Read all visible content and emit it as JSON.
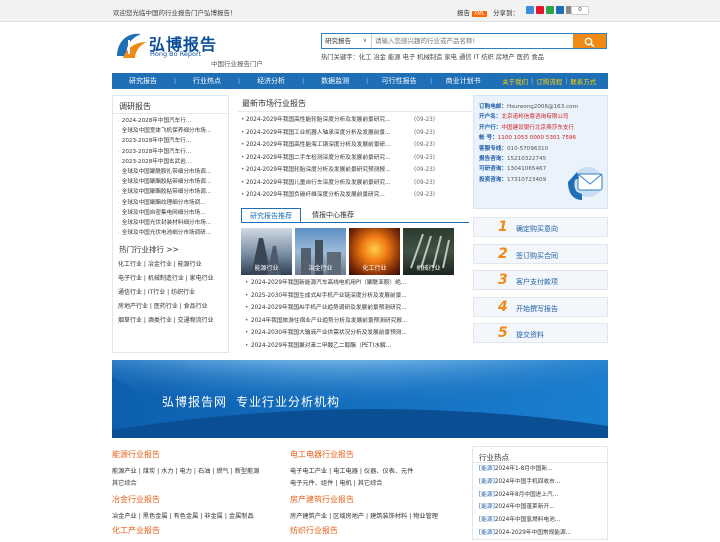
{
  "topbar": {
    "welcome": "欢迎您光临中国的行业报告门户弘博报告！",
    "rss": "报告",
    "xml": "XML",
    "share": "分享到：",
    "count": "0"
  },
  "logo": {
    "cn": "弘博报告",
    "en": "Hong Bo Report",
    "portal": "中国行业报告门户"
  },
  "search": {
    "select": "研究报告",
    "placeholder": "请输入您感兴趣的行业或产品名称!",
    "hot": "热门关键字：化工 冶金 能源 电子 机械制造 家电 通信 IT 纺织 房地产 医药 食品"
  },
  "nav": {
    "items": [
      "研究报告",
      "行业热点",
      "经济分析",
      "数据监测",
      "可行性报告",
      "商业计划书"
    ],
    "ext": [
      "关于我们",
      "订购流程",
      "联系方式"
    ]
  },
  "left": {
    "title": "调研报告",
    "items": [
      "2024-2028年中国汽车行...",
      "全球及中国宽体飞机保养细分市场...",
      "2023-2028年中国汽车行...",
      "2023-2028年中国汽车行...",
      "2023-2028年中国玄武岩...",
      "全球及中国聚酰胺扎带细分市场调...",
      "全球及中国聚酯胶粘带细分市场调...",
      "全球及中国聚酯胶粘带细分市场调...",
      "全球及中国聚酯纹理细分市场调...",
      "全球及中国自密集电网细分市场...",
      "全球及中国光伏封装材料细分市场...",
      "全球及中国光伏电池细分市场调研..."
    ],
    "hot_title": "热门行业排行  >>",
    "hot": [
      "化工行业 | 冶金行业 | 能源行业",
      "电子行业 | 机械制造行业 | 家电行业",
      "通信行业 | IT行业 | 纺织行业",
      "房地产行业 | 医药行业 | 食品行业",
      "烟草行业 | 酒类行业 | 交通物流行业"
    ]
  },
  "mid": {
    "title": "最新市场行业报告",
    "news": [
      {
        "t": "2024-2029年我国高性能轮胎深度分析及发展前景研究...",
        "d": "(09-23)"
      },
      {
        "t": "2024-2029年我国工业机器人轴承深度分析及发展前景...",
        "d": "(09-23)"
      },
      {
        "t": "2024-2029年我国高性能海工钢深度分析及发展前景研...",
        "d": "(09-23)"
      },
      {
        "t": "2024-2029年我国二手车检测深度分析及发展前景研究...",
        "d": "(09-23)"
      },
      {
        "t": "2024-2029年我国轮胎深度分析及发展前景研究预测报...",
        "d": "(09-23)"
      },
      {
        "t": "2024-2029年我国儿童自行车深度分析及发展前景研究...",
        "d": "(09-23)"
      },
      {
        "t": "2024-2029年我国负碳纤维深度分析及发展前景研究...",
        "d": "(09-23)"
      }
    ],
    "tab1": "研究报告推荐",
    "tab2": "情报中心推荐",
    "thumbs": [
      "能源行业",
      "冶金行业",
      "化工行业",
      "机械行业"
    ],
    "news2": [
      "2024-2029年我国新能源汽车高线电机用PI（聚酰亚胺）绝...",
      "2025-2030年我国生成式AI手机产业链深度分析及发展前景...",
      "2024-2029年我国AI手机产业趋势调研及发展前景预测研究...",
      "2024年我国旅游住宿业产业趋势分析及发展前景预测研究报...",
      "2024-2030年我国大输液产业供需状况分析及发展前景预测...",
      "2024-2029年我国聚对苯二甲酸乙二醇酯（PET)水解..."
    ]
  },
  "contact": [
    {
      "k": "订购电邮：",
      "v": "Hsureong2006@163.com",
      "c": "v2"
    },
    {
      "k": "开户名：",
      "v": "北京诺邦信恩咨询有限公司",
      "c": "v"
    },
    {
      "k": "开户行：",
      "v": "中国建设银行北京燕莎东支行",
      "c": "v"
    },
    {
      "k": "帐    号：",
      "v": "1100 1053 0000 5301 7596",
      "c": "v"
    },
    {
      "k": "客服专线：",
      "v": "010-57096310",
      "c": "v2"
    },
    {
      "k": "报告咨询：",
      "v": "15210322745",
      "c": "v2"
    },
    {
      "k": "可研咨询：",
      "v": "13041065467",
      "c": "v2"
    },
    {
      "k": "投资咨询：",
      "v": "17310723409",
      "c": "v2"
    }
  ],
  "steps": [
    {
      "n": "1",
      "s": "确定购买意向"
    },
    {
      "n": "2",
      "s": "签订购买合同"
    },
    {
      "n": "3",
      "s": "客户支付款项"
    },
    {
      "n": "4",
      "s": "开始撰写报告"
    },
    {
      "n": "5",
      "s": "提交资料"
    }
  ],
  "banner": {
    "a": "弘博报告网",
    "b": "专业行业分析机构"
  },
  "cats": [
    {
      "h": "能源行业报告",
      "lines": [
        "能源产业 | 煤炭 | 水力 | 电力 | 石油 | 燃气 | 新型能源",
        "其它综合"
      ]
    },
    {
      "h": "冶金行业报告",
      "lines": [
        "冶金产业 | 黑色金属 | 有色金属 | 非金属 | 金属制品"
      ]
    },
    {
      "h": "化工产业报告",
      "lines": []
    },
    {
      "h": "电工电器行业报告",
      "lines": [
        "电子电工产业 | 电工电器 | 仪器、仪表、元件",
        "电子元件、组件 | 电机 | 其它综合"
      ]
    },
    {
      "h": "房产建筑行业报告",
      "lines": [
        "房产建筑产业 | 区域房地产 | 建筑装饰材料 | 物业管理"
      ]
    },
    {
      "h": "纺织行业报告",
      "lines": []
    }
  ],
  "hotnews": {
    "title": "行业热点",
    "items": [
      [
        "[能源]",
        "2024年1-8月中国新..."
      ],
      [
        "[能源]",
        "2024年中国手机回收市..."
      ],
      [
        "[能源]",
        "2024年8月中国进上汽..."
      ],
      [
        "[能源]",
        "2024年中国蓬莱新开..."
      ],
      [
        "[能源]",
        "2024年中国氢燃料电池..."
      ],
      [
        "[能源]",
        "2024-2029年中国常规能源..."
      ]
    ]
  }
}
